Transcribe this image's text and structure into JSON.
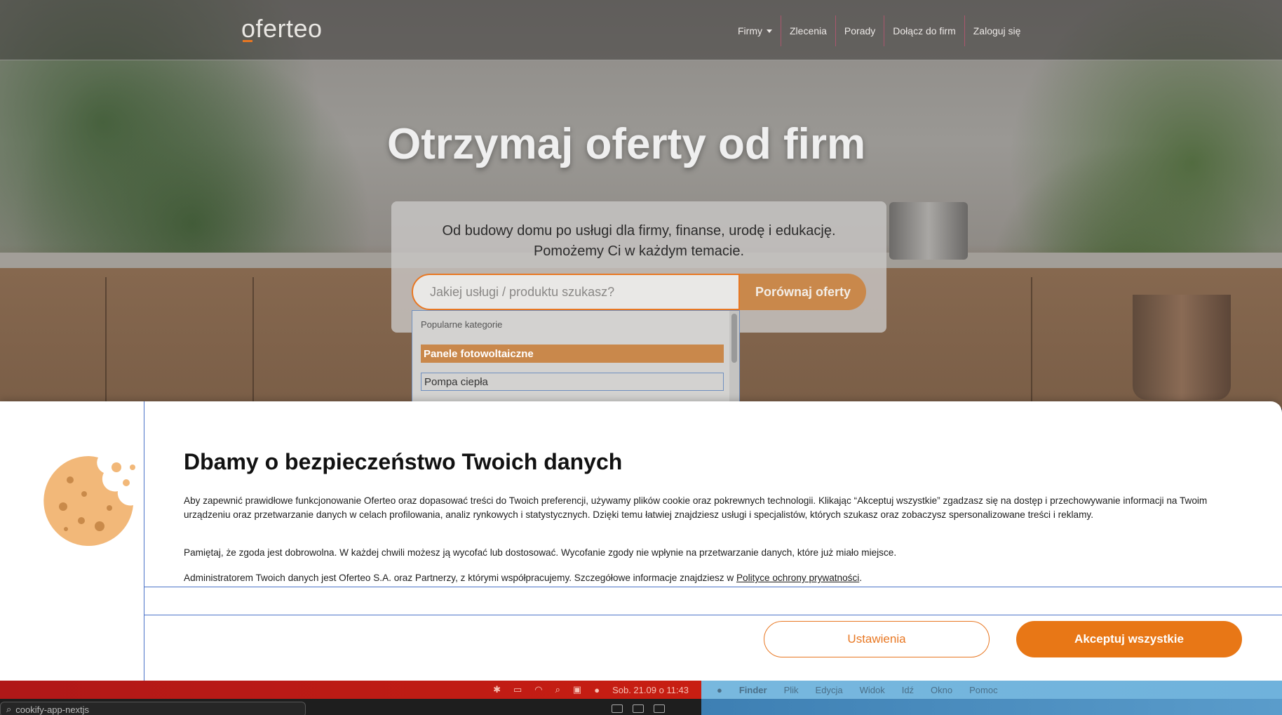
{
  "header": {
    "logo": "oferteo",
    "nav": [
      {
        "label": "Firmy"
      },
      {
        "label": "Zlecenia"
      },
      {
        "label": "Porady"
      },
      {
        "label": "Dołącz do firm"
      },
      {
        "label": "Zaloguj się"
      }
    ]
  },
  "hero": {
    "headline": "Otrzymaj oferty od firm",
    "subline_1": "Od budowy domu po usługi dla firmy, finanse, urodę i edukację.",
    "subline_2": "Pomożemy Ci w każdym temacie.",
    "search_placeholder": "Jakiej usługi / produktu szukasz?",
    "search_button": "Porównaj oferty",
    "dropdown": {
      "heading": "Popularne kategorie",
      "items": [
        "Panele fotowoltaiczne",
        "Pompa ciepła"
      ]
    }
  },
  "cookie": {
    "title": "Dbamy o bezpieczeństwo Twoich danych",
    "para1_a": "Aby zapewnić prawidłowe funkcjonowanie Oferteo oraz dopasować treści do Twoich preferencji, używamy plików cookie oraz pokrewnych technologii. Klikając “Akceptuj wszystkie” zgadzasz się na dostęp i przechowywanie informacji na Twoim urządzeniu oraz przetwarzanie danych w celach profilowania, analiz rynkowych i statystycznych.",
    "para1_b": "Dzięki temu łatwiej znajdziesz usługi i specjalistów, których szukasz oraz zobaczysz spersonalizowane treści i reklamy.",
    "para2": "Pamiętaj, że zgoda jest dobrowolna. W każdej chwili możesz ją wycofać lub dostosować. Wycofanie zgody nie wpłynie na przetwarzanie danych, które już miało miejsce.",
    "para3": "Administratorem Twoich danych jest Oferteo S.A. oraz Partnerzy, z którymi współpracujemy. Szczegółowe informacje znajdziesz w",
    "privacy_link": "Polityce ochrony prywatności",
    "para3_end": ".",
    "settings_button": "Ustawienia",
    "accept_button": "Akceptuj wszystkie"
  },
  "menubar_left": {
    "datetime": "Sob. 21.09 o  11:43"
  },
  "menubar_right": {
    "items": [
      "Finder",
      "Plik",
      "Edycja",
      "Widok",
      "Idź",
      "Okno",
      "Pomoc"
    ]
  },
  "taskbar": {
    "tab_title": "cookify-app-nextjs"
  }
}
